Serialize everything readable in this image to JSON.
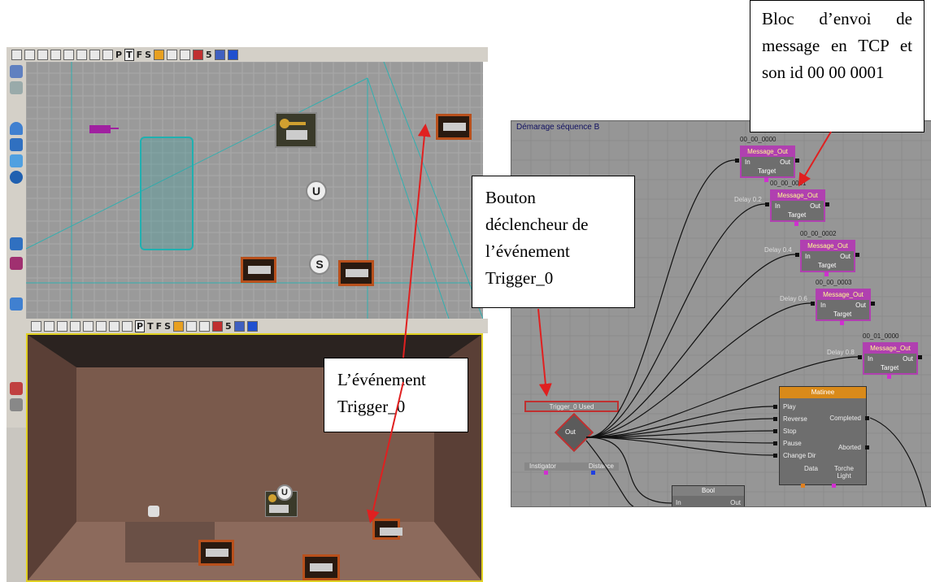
{
  "callouts": {
    "bloc": "Bloc d’envoi de message en TCP et son id 00 00 0001",
    "bouton": "Bouton déclencheur de l’événement Trigger_0",
    "evenement": "L’événement Trigger_0"
  },
  "toolbar": {
    "letters": [
      "P",
      "T",
      "F",
      "S"
    ],
    "five": "5"
  },
  "top_view": {
    "actor_letters": {
      "u": "U",
      "s": "S"
    }
  },
  "persp_view": {
    "actor_letters": {
      "u": "U"
    }
  },
  "kismet": {
    "title": "Démarage séquence B",
    "nodes": [
      {
        "id": "00_00_0000",
        "title": "Message_Out",
        "in": "In",
        "out": "Out",
        "target": "Target",
        "delay": ""
      },
      {
        "id": "00_00_0001",
        "title": "Message_Out",
        "in": "In",
        "out": "Out",
        "target": "Target",
        "delay": "Delay 0.2"
      },
      {
        "id": "00_00_0002",
        "title": "Message_Out",
        "in": "In",
        "out": "Out",
        "target": "Target",
        "delay": "Delay 0.4"
      },
      {
        "id": "00_00_0003",
        "title": "Message_Out",
        "in": "In",
        "out": "Out",
        "target": "Target",
        "delay": "Delay 0.6"
      },
      {
        "id": "00_01_0000",
        "title": "Message_Out",
        "in": "In",
        "out": "Out",
        "target": "Target",
        "delay": "Delay 0.8"
      }
    ],
    "trigger": {
      "title": "Trigger_0 Used",
      "out": "Out",
      "instigator": "Instigator",
      "distance": "Distance"
    },
    "matinee": {
      "title": "Matinee",
      "inputs": [
        "Play",
        "Reverse",
        "Stop",
        "Pause",
        "Change Dir"
      ],
      "outputs": [
        "Completed",
        "Aborted"
      ],
      "vars": [
        "Data",
        "Torche Light"
      ]
    },
    "bool": {
      "title": "Bool",
      "in": "In",
      "out": "Out"
    }
  },
  "colors": {
    "annotation_arrow": "#e02020",
    "kismet_node_border": "#b040b0",
    "matinee_header": "#d98a1a"
  }
}
